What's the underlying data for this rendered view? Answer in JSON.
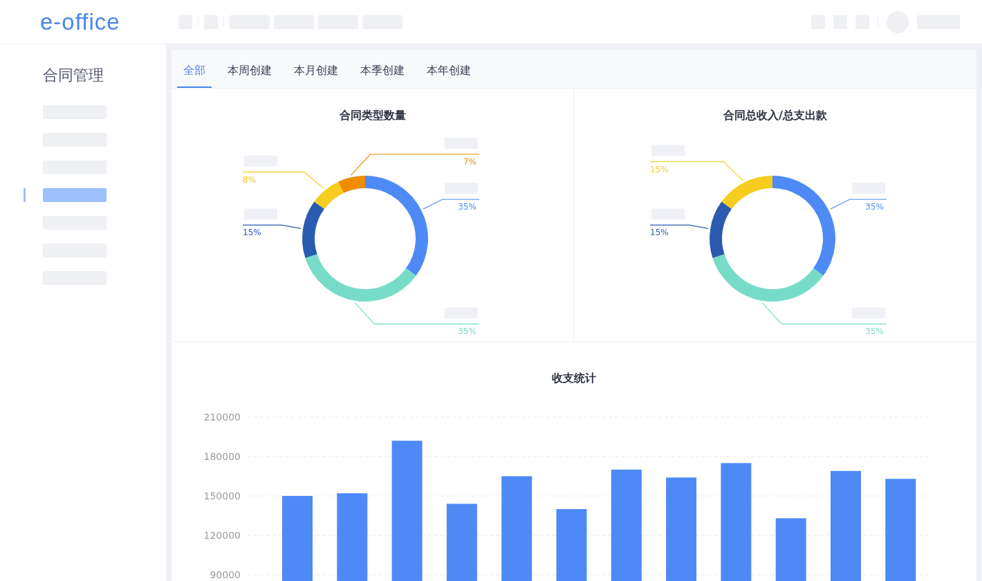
{
  "header": {
    "logo": "e-office"
  },
  "sidebar": {
    "title": "合同管理",
    "items": [
      {
        "selected": false
      },
      {
        "selected": false
      },
      {
        "selected": false
      },
      {
        "selected": true
      },
      {
        "selected": false
      },
      {
        "selected": false
      },
      {
        "selected": false
      }
    ]
  },
  "tabs": [
    {
      "label": "全部",
      "selected": true
    },
    {
      "label": "本周创建",
      "selected": false
    },
    {
      "label": "本月创建",
      "selected": false
    },
    {
      "label": "本季创建",
      "selected": false
    },
    {
      "label": "本年创建",
      "selected": false
    }
  ],
  "donuts": [
    {
      "chart_data": {
        "type": "donut",
        "title": "合同类型数量",
        "values": [
          35,
          35,
          15,
          8,
          7
        ],
        "value_labels": [
          "35%",
          "35%",
          "15%",
          "8%",
          "7%"
        ],
        "colors": [
          "#4e8af6",
          "#76dcc8",
          "#2a5bb0",
          "#f5cc1f",
          "#ef8c00"
        ]
      }
    },
    {
      "chart_data": {
        "type": "donut",
        "title": "合同总收入/总支出款",
        "values": [
          35,
          35,
          15,
          15
        ],
        "value_labels": [
          "35%",
          "35%",
          "15%",
          "15%"
        ],
        "colors": [
          "#4e8af6",
          "#76dcc8",
          "#2a5bb0",
          "#f5cc1f"
        ]
      }
    }
  ],
  "bar_panel": {
    "chart_data": {
      "type": "bar",
      "title": "收支统计",
      "series": [
        {
          "color": "#4e8af6",
          "values": [
            150000,
            152000,
            192000,
            144000,
            165000,
            140000,
            170000,
            164000,
            175000,
            133000,
            169000,
            163000
          ]
        }
      ],
      "yticks": [
        {
          "value": 210000,
          "label": "210000"
        },
        {
          "value": 180000,
          "label": "180000"
        },
        {
          "value": 150000,
          "label": "150000"
        },
        {
          "value": 120000,
          "label": "120000"
        },
        {
          "value": 90000,
          "label": "90000"
        }
      ],
      "ylim": [
        84000,
        210000
      ],
      "grid": true
    }
  }
}
